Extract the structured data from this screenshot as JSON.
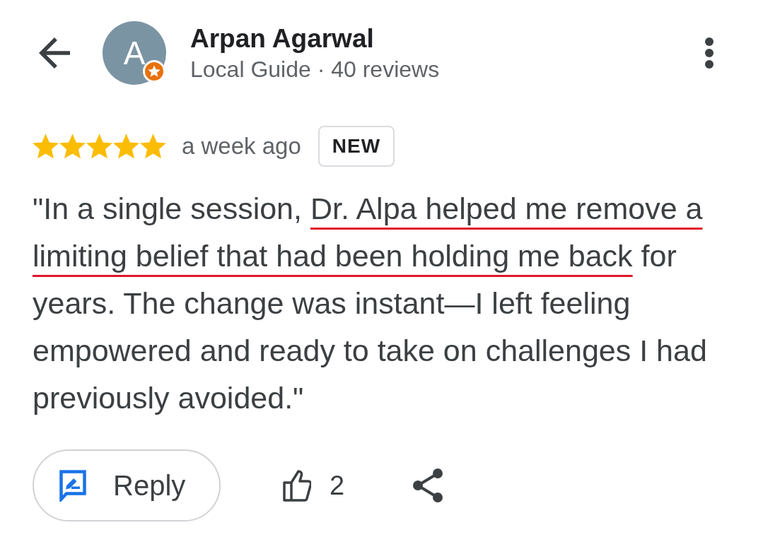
{
  "header": {
    "reviewer": {
      "avatar_letter": "A",
      "local_guide": true,
      "name": "Arpan Agarwal",
      "subtitle": "Local Guide · 40 reviews"
    }
  },
  "review": {
    "stars": 5,
    "time": "a week ago",
    "badge": "NEW",
    "text": [
      {
        "text": "\"In a single session, ",
        "underlined": false
      },
      {
        "text": "Dr. Alpa helped me remove a limiting belief that had been holding me back",
        "underlined": true
      },
      {
        "text": " for years. The change was instant—I left feeling empowered and ready to take on challenges I had previously avoided.\"",
        "underlined": false
      }
    ]
  },
  "actions": {
    "reply": "Reply",
    "likes": "2"
  }
}
